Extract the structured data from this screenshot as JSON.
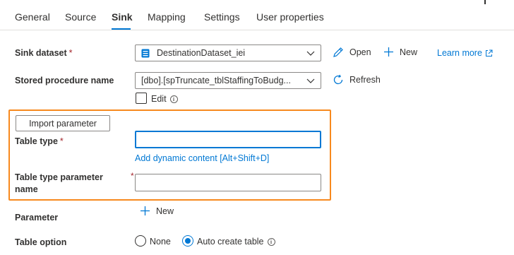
{
  "tabs": [
    {
      "label": "General"
    },
    {
      "label": "Source"
    },
    {
      "label": "Sink"
    },
    {
      "label": "Mapping"
    },
    {
      "label": "Settings"
    },
    {
      "label": "User properties"
    }
  ],
  "active_tab": "Sink",
  "sink_dataset": {
    "label": "Sink dataset",
    "required_mark": "*",
    "value": "DestinationDataset_iei",
    "open_label": "Open",
    "new_label": "New",
    "learn_more_label": "Learn more"
  },
  "stored_procedure": {
    "label": "Stored procedure name",
    "value": "[dbo].[spTruncate_tblStaffingToBudg...",
    "refresh_label": "Refresh",
    "edit_label": "Edit",
    "edit_checked": false
  },
  "import_parameter": {
    "button_label": "Import parameter"
  },
  "table_type": {
    "label": "Table type",
    "required_mark": "*",
    "value": "",
    "dynamic_content_link": "Add dynamic content [Alt+Shift+D]"
  },
  "table_type_parameter": {
    "label_line1": "Table type parameter",
    "label_line2": "name",
    "required_mark": "*",
    "value": ""
  },
  "parameter": {
    "label": "Parameter",
    "new_label": "New"
  },
  "table_option": {
    "label": "Table option",
    "options": [
      {
        "label": "None",
        "selected": false
      },
      {
        "label": "Auto create table",
        "selected": true
      }
    ]
  },
  "colors": {
    "accent": "#0078d4",
    "highlight": "#f7891e",
    "required": "#a4262c"
  },
  "icons": [
    "dataset-icon",
    "chevron-down-icon",
    "pencil-icon",
    "plus-icon",
    "external-link-icon",
    "refresh-icon",
    "info-icon"
  ]
}
